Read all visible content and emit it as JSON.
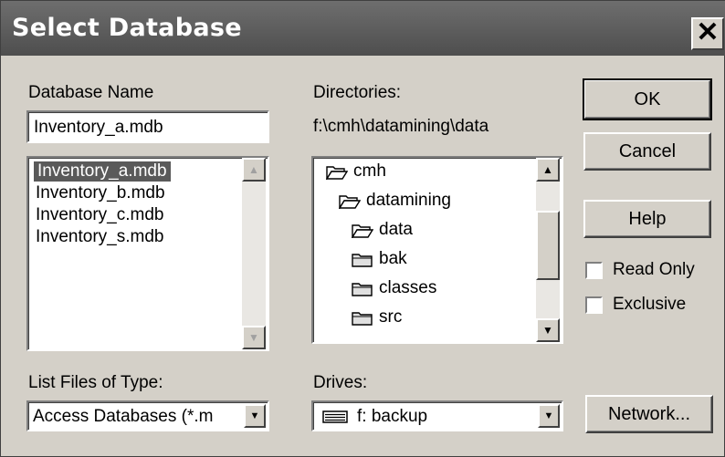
{
  "window": {
    "title": "Select Database",
    "close_glyph": "✕"
  },
  "database_name": {
    "label": "Database Name",
    "value": "Inventory_a.mdb",
    "files": [
      "Inventory_a.mdb",
      "Inventory_b.mdb",
      "Inventory_c.mdb",
      "Inventory_s.mdb"
    ],
    "selected_index": 0
  },
  "directories": {
    "label": "Directories:",
    "current_path": "f:\\cmh\\datamining\\data",
    "items": [
      {
        "name": "cmh",
        "icon": "folder-open-icon"
      },
      {
        "name": "datamining",
        "icon": "folder-open-icon"
      },
      {
        "name": "data",
        "icon": "folder-open-icon"
      },
      {
        "name": "bak",
        "icon": "folder-closed-icon"
      },
      {
        "name": "classes",
        "icon": "folder-closed-icon"
      },
      {
        "name": "src",
        "icon": "folder-closed-icon"
      }
    ]
  },
  "buttons": {
    "ok": "OK",
    "cancel": "Cancel",
    "help": "Help",
    "network": "Network..."
  },
  "options": {
    "read_only": "Read Only",
    "exclusive": "Exclusive",
    "read_only_checked": false,
    "exclusive_checked": false
  },
  "file_type": {
    "label": "List Files of Type:",
    "value": "Access Databases (*.m"
  },
  "drives": {
    "label": "Drives:",
    "value": "f: backup",
    "icon": "drive-icon"
  },
  "glyphs": {
    "up": "▲",
    "down": "▼"
  }
}
